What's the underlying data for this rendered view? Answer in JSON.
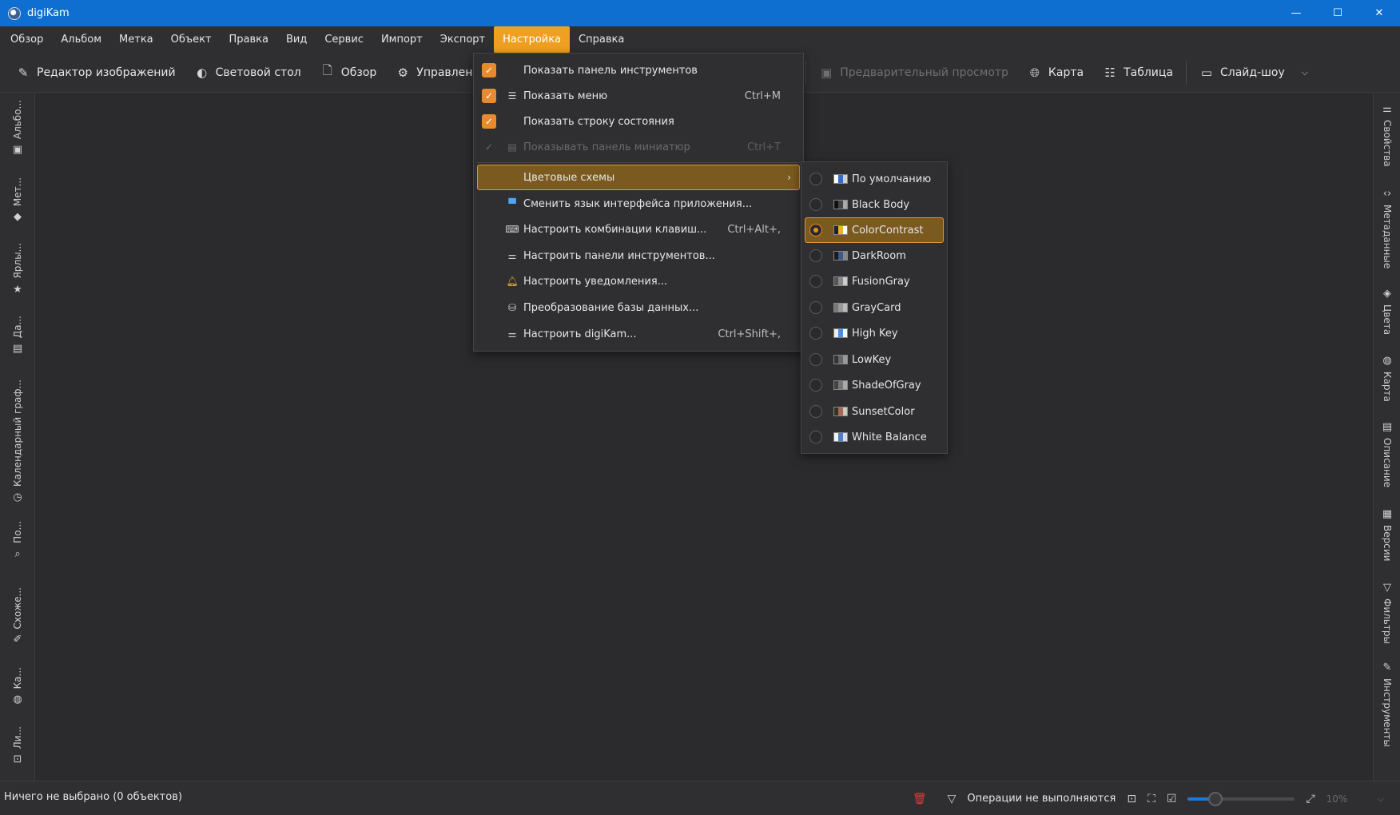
{
  "window": {
    "title": "digiKam",
    "controls": {
      "minimize": "—",
      "maximize": "☐",
      "close": "✕"
    }
  },
  "menubar": {
    "items": [
      "Обзор",
      "Альбом",
      "Метка",
      "Объект",
      "Правка",
      "Вид",
      "Сервис",
      "Импорт",
      "Экспорт",
      "Настройка",
      "Справка"
    ],
    "active_index": 9
  },
  "toolbar": {
    "image_editor": "Редактор изображений",
    "light_table": "Световой стол",
    "browse": "Обзор",
    "queue_manager": "Управление очеред",
    "preview": "Предварительный просмотр",
    "map": "Карта",
    "table": "Таблица",
    "slideshow": "Слайд-шоу"
  },
  "left_tabs": [
    {
      "label": "Альбо...",
      "icon": "album-icon"
    },
    {
      "label": "Мет...",
      "icon": "tag-icon"
    },
    {
      "label": "Ярлы...",
      "icon": "star-icon"
    },
    {
      "label": "Да...",
      "icon": "calendar-icon"
    },
    {
      "label": "Календарный граф...",
      "icon": "timeline-icon"
    },
    {
      "label": "По...",
      "icon": "search-icon"
    },
    {
      "label": "Схоже...",
      "icon": "similar-icon"
    },
    {
      "label": "Ка...",
      "icon": "globe-icon"
    },
    {
      "label": "Ли...",
      "icon": "face-icon"
    }
  ],
  "right_tabs": [
    {
      "label": "Свойства",
      "icon": "sliders-icon"
    },
    {
      "label": "Метаданные",
      "icon": "code-icon"
    },
    {
      "label": "Цвета",
      "icon": "paint-icon"
    },
    {
      "label": "Карта",
      "icon": "globe-icon"
    },
    {
      "label": "Описание",
      "icon": "description-icon"
    },
    {
      "label": "Версии",
      "icon": "versions-icon"
    },
    {
      "label": "Фильтры",
      "icon": "filter-icon"
    },
    {
      "label": "Инструменты",
      "icon": "tools-icon"
    }
  ],
  "settings_menu": {
    "show_toolbar": "Показать панель инструментов",
    "show_menu": "Показать меню",
    "show_menu_shortcut": "Ctrl+M",
    "show_statusbar": "Показать строку состояния",
    "show_thumbbar": "Показывать панель миниатюр",
    "show_thumbbar_shortcut": "Ctrl+T",
    "color_schemes": "Цветовые схемы",
    "change_language": "Сменить язык интерфейса приложения...",
    "configure_shortcuts": "Настроить комбинации клавиш...",
    "configure_shortcuts_shortcut": "Ctrl+Alt+,",
    "configure_toolbars": "Настроить панели инструментов...",
    "configure_notifications": "Настроить уведомления...",
    "database_migration": "Преобразование базы данных...",
    "configure_digikam": "Настроить digiKam...",
    "configure_digikam_shortcut": "Ctrl+Shift+,"
  },
  "color_schemes": {
    "items": [
      "По умолчанию",
      "Black Body",
      "ColorContrast",
      "DarkRoom",
      "FusionGray",
      "GrayCard",
      "High Key",
      "LowKey",
      "ShadeOfGray",
      "SunsetColor",
      "White Balance"
    ],
    "selected_index": 2
  },
  "statusbar": {
    "selection_text": "Ничего не выбрано (0 объектов)",
    "operations_text": "Операции не выполняются",
    "zoom_value": "10%",
    "zoom_fraction": 0.26
  },
  "colors": {
    "accent": "#f0a020",
    "titlebar": "#0e6fd1",
    "highlight_bg": "#7a5a1f",
    "highlight_border": "#d99a2b",
    "checkbox": "#e88a2e"
  }
}
